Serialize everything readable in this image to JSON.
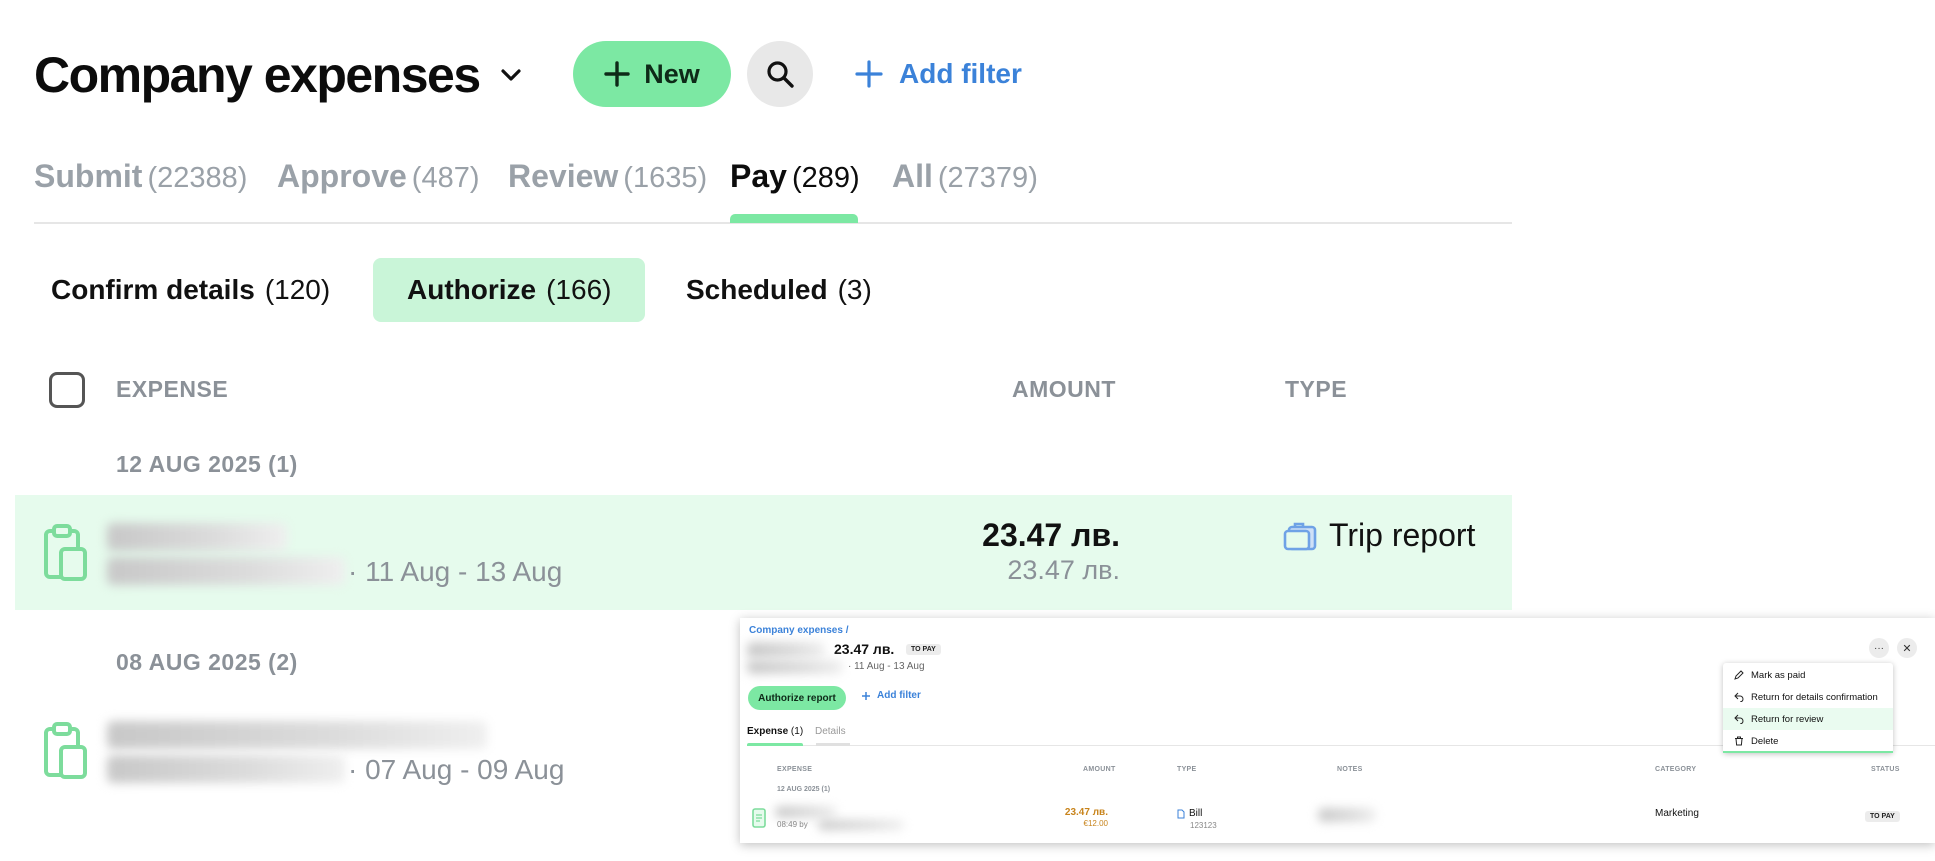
{
  "header": {
    "title": "Company expenses",
    "new_label": "New",
    "add_filter_label": "Add filter"
  },
  "tabs": [
    {
      "label": "Submit",
      "count": "(22388)"
    },
    {
      "label": "Approve",
      "count": "(487)"
    },
    {
      "label": "Review",
      "count": "(1635)"
    },
    {
      "label": "Pay",
      "count": "(289)"
    },
    {
      "label": "All",
      "count": "(27379)"
    }
  ],
  "active_tab": "Pay",
  "subtabs": [
    {
      "label": "Confirm details",
      "count": "(120)"
    },
    {
      "label": "Authorize",
      "count": "(166)"
    },
    {
      "label": "Scheduled",
      "count": "(3)"
    }
  ],
  "active_subtab": "Authorize",
  "table": {
    "columns": {
      "expense": "EXPENSE",
      "amount": "AMOUNT",
      "type": "TYPE"
    },
    "groups": [
      {
        "label": "12 AUG 2025 (1)",
        "rows": [
          {
            "date_range": "· 11 Aug - 13 Aug",
            "amount": "23.47 лв.",
            "amount_secondary": "23.47 лв.",
            "type": "Trip report",
            "selected": true
          }
        ]
      },
      {
        "label": "08 AUG 2025 (2)",
        "rows": [
          {
            "date_range": "· 07 Aug - 09 Aug"
          }
        ]
      }
    ]
  },
  "preview": {
    "breadcrumb": "Company expenses /",
    "amount": "23.47 лв.",
    "badge": "TO PAY",
    "dates": "· 11 Aug - 13 Aug",
    "authorize_label": "Authorize report",
    "add_filter_label": "Add filter",
    "tabs": [
      {
        "label": "Expense",
        "count": "(1)"
      },
      {
        "label": "Details"
      }
    ],
    "columns": [
      "EXPENSE",
      "AMOUNT",
      "TYPE",
      "NOTES",
      "CATEGORY",
      "STATUS"
    ],
    "group_label": "12 AUG 2025 (1)",
    "row": {
      "time": "08:49 by",
      "amount": "23.47 лв.",
      "amount_secondary": "€12.00",
      "type": "Bill",
      "bill_number": "123123",
      "category": "Marketing",
      "status": "TO PAY"
    },
    "menu": [
      {
        "label": "Mark as paid",
        "icon": "pencil-icon"
      },
      {
        "label": "Return for details confirmation",
        "icon": "return-icon"
      },
      {
        "label": "Return for review",
        "icon": "return-icon"
      },
      {
        "label": "Delete",
        "icon": "trash-icon"
      }
    ]
  },
  "colors": {
    "accent_green": "#7ce8a3",
    "accent_blue": "#3b82d9",
    "selected_row": "#e6fbed",
    "muted_text": "#8b9198",
    "amount_orange": "#c8841c"
  }
}
